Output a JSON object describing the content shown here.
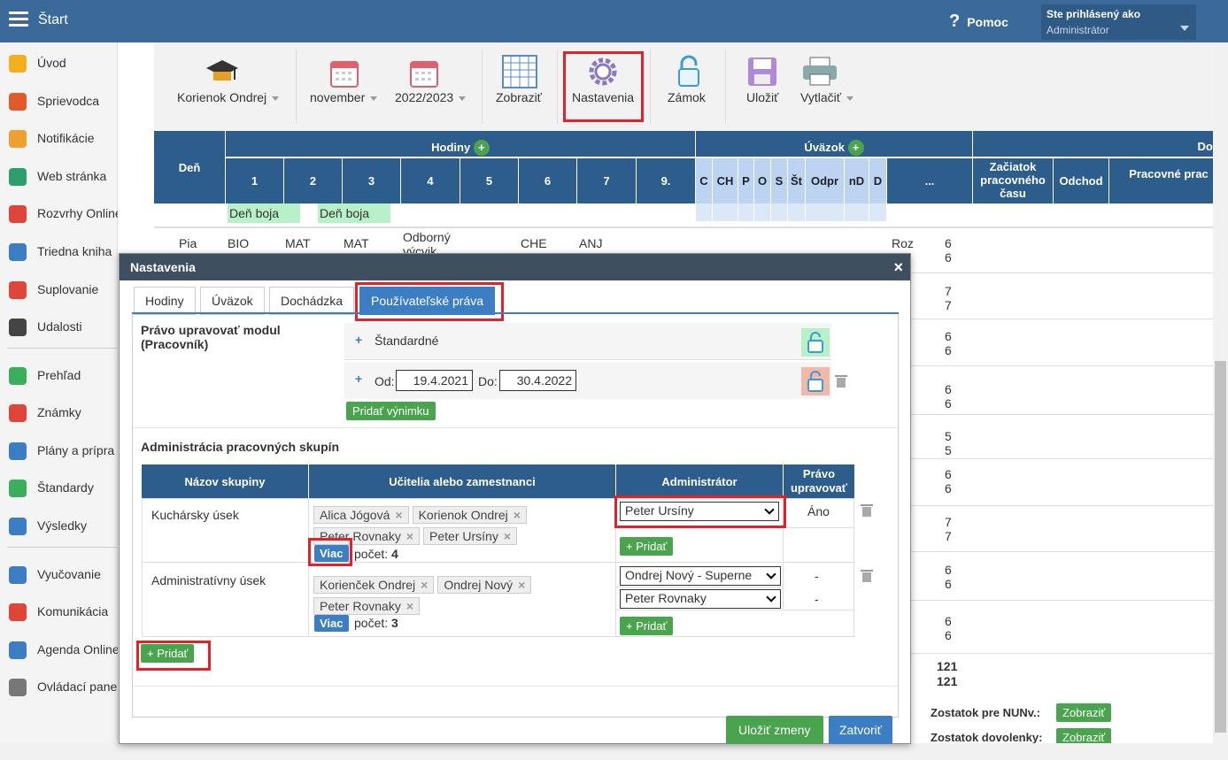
{
  "topbar": {
    "title": "Štart",
    "help": "Pomoc",
    "user_label": "Ste prihlásený ako",
    "user_value": "Administrátor"
  },
  "sidebar": {
    "items": [
      {
        "label": "Úvod",
        "icon": "star-icon",
        "color": "#f2b01e"
      },
      {
        "label": "Sprievodca",
        "icon": "wand-icon",
        "color": "#e05a2a"
      },
      {
        "label": "Notifikácie",
        "icon": "envelope-icon",
        "color": "#f0a030"
      },
      {
        "label": "Web stránka",
        "icon": "house-icon",
        "color": "#2e9e6a"
      },
      {
        "label": "Rozvrhy Online",
        "icon": "grid-icon",
        "color": "#e0453a"
      },
      {
        "label": "Triedna kniha",
        "icon": "book-icon",
        "color": "#3b7ec4"
      },
      {
        "label": "Suplovanie",
        "icon": "person-icon",
        "color": "#e0453a"
      },
      {
        "label": "Udalosti",
        "icon": "calendar-icon",
        "color": "#444"
      },
      {
        "label": "Prehľad",
        "icon": "check-circle-icon",
        "color": "#3aae5a"
      },
      {
        "label": "Známky",
        "icon": "grade-icon",
        "color": "#e0453a"
      },
      {
        "label": "Plány a prípra",
        "icon": "briefcase-icon",
        "color": "#3b7ec4"
      },
      {
        "label": "Štandardy",
        "icon": "shield-icon",
        "color": "#3aae5a"
      },
      {
        "label": "Výsledky",
        "icon": "bar-chart-icon",
        "color": "#3b7ec4"
      },
      {
        "label": "Vyučovanie",
        "icon": "open-book-icon",
        "color": "#3b7ec4"
      },
      {
        "label": "Komunikácia",
        "icon": "chat-icon",
        "color": "#e0453a"
      },
      {
        "label": "Agenda Online",
        "icon": "pen-icon",
        "color": "#3b7ec4"
      },
      {
        "label": "Ovládací pane",
        "icon": "gear-icon",
        "color": "#777"
      }
    ]
  },
  "toolbar": {
    "teacher": "Korienok Ondrej",
    "month": "november",
    "year": "2022/2023",
    "show": "Zobraziť",
    "settings": "Nastavenia",
    "lock": "Zámok",
    "save": "Uložiť",
    "print": "Vytlačiť"
  },
  "grid": {
    "day_header": "Deň",
    "hours_header": "Hodiny",
    "uvazok_header": "Úväzok",
    "doch_header": "Doc",
    "hour_cols": [
      "1",
      "2",
      "3",
      "4",
      "5",
      "6",
      "7",
      "9."
    ],
    "uv_cols": [
      "C",
      "CH",
      "P",
      "O",
      "S",
      "Št",
      "Odpr",
      "nD",
      "D"
    ],
    "dots": "...",
    "d_cols": [
      "Začiatok pracovného času",
      "Odchod",
      "Pracovné prac"
    ],
    "holiday": [
      "Deň boja",
      "Deň boja"
    ],
    "row_day": "Pia",
    "row_cells": [
      "BIO",
      "MAT",
      "MAT",
      "Odborný výcvik",
      "CHE",
      "ANJ"
    ],
    "roz": "Roz",
    "right_nums": [
      "6",
      "6",
      "7",
      "7",
      "6",
      "6",
      "6",
      "6",
      "5",
      "5",
      "6",
      "6",
      "7",
      "7",
      "6",
      "6",
      "6",
      "6"
    ],
    "total": [
      "121",
      "121"
    ],
    "balances": [
      {
        "label": "Zostatok pre NUNv.:",
        "btn": "Zobraziť"
      },
      {
        "label": "Zostatok dovolenky:",
        "btn": "Zobraziť"
      }
    ]
  },
  "dialog": {
    "title": "Nastavenia",
    "close": "×",
    "tabs": [
      "Hodiny",
      "Úväzok",
      "Dochádzka",
      "Používateľské práva"
    ],
    "right_title": "Právo upravovať modul (Pracovník)",
    "standard": "Štandardné",
    "from_label": "Od:",
    "from": "19.4.2021",
    "to_label": "Do:",
    "to": "30.4.2022",
    "add_exception": "Pridať výnimku",
    "groups_title": "Administrácia pracovných skupín",
    "headers": [
      "Názov skupiny",
      "Učitelia alebo zamestnanci",
      "Administrátor",
      "Právo upravovať"
    ],
    "groups": [
      {
        "name": "Kuchársky úsek",
        "members": [
          "Alica Jógová",
          "Korienok Ondrej",
          "Peter Rovnaky",
          "Peter Ursíny"
        ],
        "more": "Viac",
        "count_label": "počet:",
        "count": "4",
        "admins": [
          {
            "value": "Peter Ursíny",
            "right": "Áno"
          }
        ],
        "add": "+ Pridať"
      },
      {
        "name": "Administratívny úsek",
        "members": [
          "Korienček Ondrej",
          "Ondrej Nový",
          "Peter Rovnaky"
        ],
        "more": "Viac",
        "count_label": "počet:",
        "count": "3",
        "admins": [
          {
            "value": "Ondrej Nový - Superne",
            "right": "-"
          },
          {
            "value": "Peter Rovnaky",
            "right": "-"
          }
        ],
        "add": "+ Pridať"
      }
    ],
    "add_group": "+ Pridať",
    "save": "Uložiť zmeny",
    "close_btn": "Zatvoriť"
  }
}
